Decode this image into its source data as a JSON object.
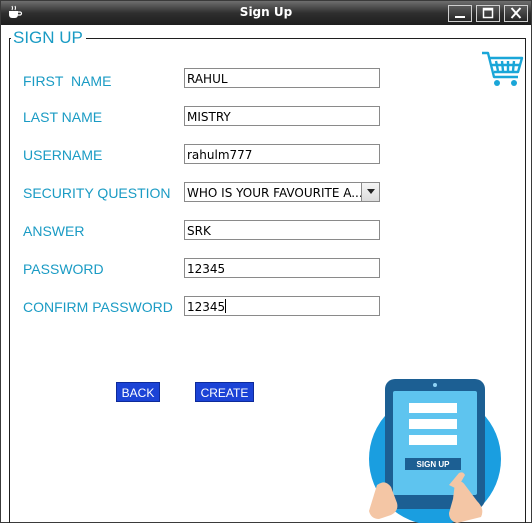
{
  "window": {
    "title": "Sign Up"
  },
  "form": {
    "legend": "SIGN UP",
    "fields": {
      "first_name": {
        "label": "FIRST  NAME",
        "value": "RAHUL"
      },
      "last_name": {
        "label": "LAST NAME",
        "value": "MISTRY"
      },
      "username": {
        "label": "USERNAME",
        "value": "rahulm777"
      },
      "security_question": {
        "label": "SECURITY QUESTION",
        "value": "WHO IS YOUR FAVOURITE A..."
      },
      "answer": {
        "label": "ANSWER",
        "value": "SRK"
      },
      "password": {
        "label": "PASSWORD",
        "value": "12345"
      },
      "confirm_password": {
        "label": "CONFIRM PASSWORD",
        "value": "12345"
      }
    },
    "buttons": {
      "back": "BACK",
      "create": "CREATE"
    }
  },
  "illustration": {
    "button_text": "SIGN UP"
  },
  "colors": {
    "accent": "#1a9bc4",
    "button": "#1b43d6",
    "titlebar": "#2f2f2f"
  },
  "icons": [
    "app-icon",
    "minimize-icon",
    "maximize-icon",
    "close-icon",
    "shopping-cart-icon",
    "dropdown-arrow-icon"
  ]
}
